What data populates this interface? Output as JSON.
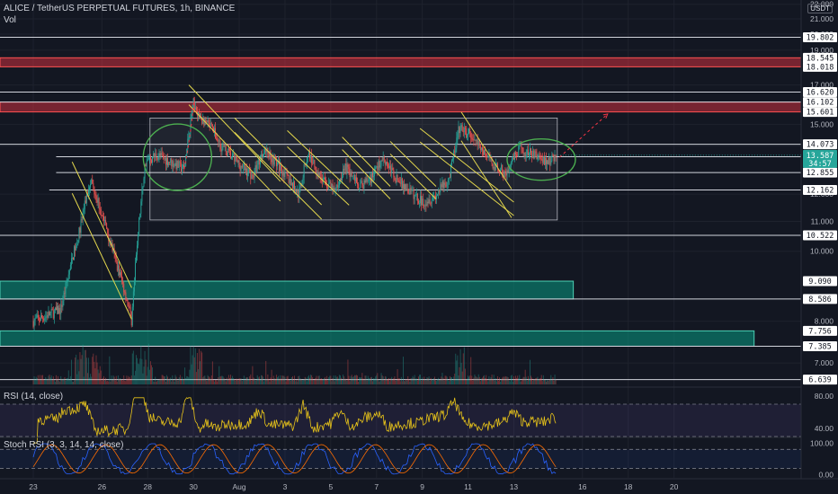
{
  "header": {
    "title": "ALICE / TetherUS PERPETUAL FUTURES, 1h, BINANCE",
    "vol_label": "Vol",
    "currency": "USDT"
  },
  "chart_data": {
    "type": "candlestick",
    "symbol": "ALICE / TetherUS PERPETUAL FUTURES",
    "interval": "1h",
    "exchange": "BINANCE",
    "price_axis": {
      "range": [
        6.5,
        22.3
      ],
      "scale": "log",
      "ticks": [
        22.0,
        21.0,
        20.0,
        19.0,
        18.0,
        17.0,
        15.0,
        14.0,
        12.0,
        11.0,
        10.0,
        8.0,
        7.0
      ]
    },
    "time_axis": {
      "labels": [
        "23",
        "26",
        "28",
        "30",
        "Aug",
        "3",
        "5",
        "7",
        "9",
        "11",
        "13",
        "16",
        "18",
        "20"
      ]
    },
    "horizontal_levels": [
      19.802,
      16.62,
      16.102,
      14.073,
      13.523,
      12.855,
      12.162,
      10.522,
      8.586,
      7.385,
      6.639
    ],
    "zones": [
      {
        "type": "resistance",
        "from": 18.018,
        "to": 18.545,
        "color": "#f23645"
      },
      {
        "type": "resistance",
        "from": 15.601,
        "to": 16.102,
        "color": "#f23645"
      },
      {
        "type": "support",
        "from": 8.586,
        "to": 9.09,
        "color": "#089981"
      },
      {
        "type": "support",
        "from": 7.385,
        "to": 7.756,
        "color": "#089981"
      }
    ],
    "range_box": {
      "from": 11.05,
      "to": 15.3
    },
    "current_price": {
      "value": "13.587",
      "countdown": "34:57"
    },
    "price_path": [
      [
        23,
        8.0
      ],
      [
        24.2,
        8.3
      ],
      [
        25.0,
        10.6
      ],
      [
        25.5,
        12.6
      ],
      [
        26.0,
        11.3
      ],
      [
        26.6,
        9.7
      ],
      [
        27.0,
        8.8
      ],
      [
        27.3,
        8.0
      ],
      [
        27.6,
        10.8
      ],
      [
        27.9,
        13.3
      ],
      [
        28.4,
        13.6
      ],
      [
        29.0,
        13.3
      ],
      [
        29.6,
        13.0
      ],
      [
        30.0,
        16.1
      ],
      [
        30.3,
        15.3
      ],
      [
        30.8,
        14.8
      ],
      [
        31.2,
        14.0
      ],
      [
        32.0,
        13.2
      ],
      [
        32.6,
        12.7
      ],
      [
        33.1,
        13.9
      ],
      [
        34.0,
        12.8
      ],
      [
        34.6,
        12.0
      ],
      [
        35.0,
        13.7
      ],
      [
        35.6,
        12.6
      ],
      [
        36.2,
        12.1
      ],
      [
        36.6,
        13.1
      ],
      [
        37.3,
        12.3
      ],
      [
        37.8,
        12.7
      ],
      [
        38.3,
        13.5
      ],
      [
        38.8,
        12.7
      ],
      [
        39.3,
        12.2
      ],
      [
        40.0,
        11.7
      ],
      [
        40.6,
        11.95
      ],
      [
        41.2,
        12.7
      ],
      [
        41.6,
        14.8
      ],
      [
        42.1,
        14.5
      ],
      [
        42.7,
        13.7
      ],
      [
        43.2,
        13.1
      ],
      [
        43.7,
        12.8
      ],
      [
        44.2,
        13.8
      ],
      [
        44.9,
        13.6
      ],
      [
        45.5,
        13.3
      ],
      [
        45.9,
        13.6
      ]
    ],
    "annotations": [
      "ellipse pre-range consolidation",
      "ellipse current consolidation",
      "descending yellow channels",
      "dashed arrows projecting breakout toward 15.601"
    ],
    "indicators": [
      {
        "name": "RSI (14, close)",
        "axis_ticks": [
          "80.00",
          "40.00"
        ],
        "range": [
          30,
          90
        ]
      },
      {
        "name": "Stoch RSI (3, 3, 14, 14, close)",
        "axis_ticks": [
          "100.00",
          "0.00"
        ],
        "range": [
          -10,
          115
        ]
      }
    ]
  },
  "colors": {
    "background": "#131722",
    "up": "#26a69a",
    "down": "#ef5350",
    "level_line": "#d1d4dc",
    "channel": "#e3d74d",
    "ellipse": "#4caf50",
    "rsi_line": "#e7c31a",
    "rsi_band": "#7e57c2",
    "stoch_k": "#2962ff",
    "stoch_d": "#ff6d00",
    "current_tag": "#26a69a"
  },
  "icons": [
    "usdt-currency-badge"
  ]
}
